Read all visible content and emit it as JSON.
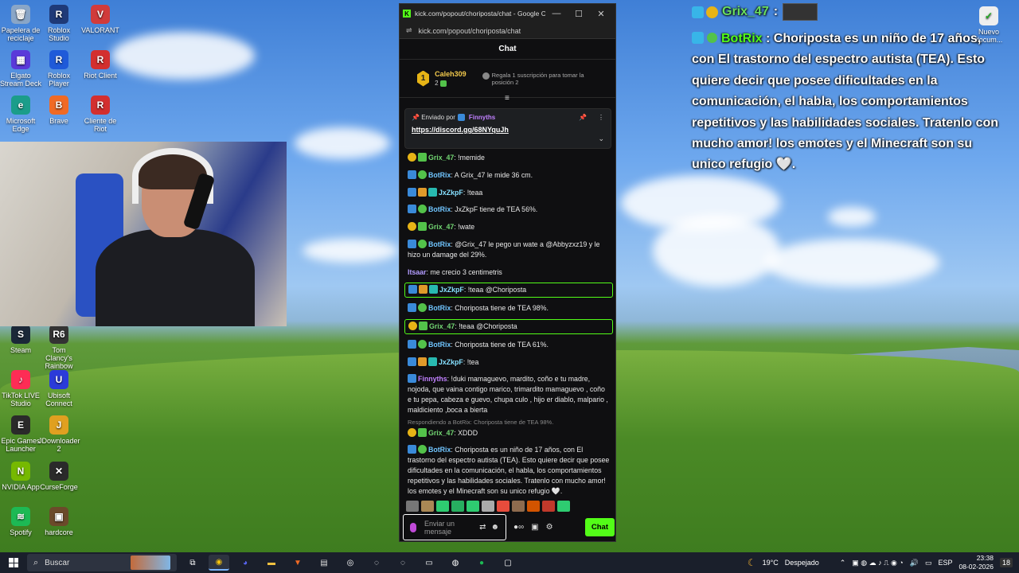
{
  "desktop": {
    "icons": [
      {
        "label": "Papelera de reciclaje",
        "color": "#8aa6c7",
        "glyph": "🗑"
      },
      {
        "label": "Roblox Studio",
        "color": "#1f3a78",
        "glyph": "R"
      },
      {
        "label": "VALORANT",
        "color": "#d13b3b",
        "glyph": "V"
      },
      {
        "label": "Elgato Stream Deck",
        "color": "#5a3ad9",
        "glyph": "▦"
      },
      {
        "label": "Roblox Player",
        "color": "#1f5ad9",
        "glyph": "R"
      },
      {
        "label": "Riot Client",
        "color": "#d32f2f",
        "glyph": "R"
      },
      {
        "label": "Microsoft Edge",
        "color": "#1b9d8a",
        "glyph": "e"
      },
      {
        "label": "Brave",
        "color": "#f06a25",
        "glyph": "B"
      },
      {
        "label": "Cliente de Riot",
        "color": "#d32f2f",
        "glyph": "R"
      },
      {
        "label": "Steam",
        "color": "#1b2838",
        "glyph": "S"
      },
      {
        "label": "Tom Clancy's Rainbow Si...",
        "color": "#333",
        "glyph": "R6"
      },
      {
        "label": "TikTok LIVE Studio",
        "color": "#fe2c55",
        "glyph": "♪"
      },
      {
        "label": "Ubisoft Connect",
        "color": "#2b3bd9",
        "glyph": "U"
      },
      {
        "label": "Epic Games Launcher",
        "color": "#2a2a2a",
        "glyph": "E"
      },
      {
        "label": "JDownloader 2",
        "color": "#e0a020",
        "glyph": "J"
      },
      {
        "label": "NVIDIA App",
        "color": "#76b900",
        "glyph": "N"
      },
      {
        "label": "CurseForge",
        "color": "#2a2a2a",
        "glyph": "✕"
      },
      {
        "label": "Spotify",
        "color": "#1db954",
        "glyph": "≋"
      },
      {
        "label": "hardcore",
        "color": "#6b4a2a",
        "glyph": "▣"
      }
    ],
    "top_right_icon": {
      "label": "Nuevo docum..."
    }
  },
  "browser": {
    "window_title": "kick.com/popout/choriposta/chat - Google C...",
    "url": "kick.com/popout/choriposta/chat",
    "chat_title": "Chat",
    "leaderboard": {
      "rank": "1",
      "user": "Caleh309",
      "subs": "2",
      "gift_text": "Regala 1 suscripción para tomar la posición 2"
    },
    "pinned": {
      "sent_by_label": "Enviado por",
      "sent_by_user": "Finnyths",
      "link": "https://discord.gg/68NYquJh"
    },
    "messages": [
      {
        "user": "Grix_47",
        "cls": "grix",
        "badges": [
          "gold",
          "green"
        ],
        "text": "!memide",
        "hl": false,
        "reply": ""
      },
      {
        "user": "BotRix",
        "cls": "bot",
        "badges": [
          "blue",
          "ok"
        ],
        "text": "A Grix_47 le mide 36 cm.",
        "hl": false,
        "reply": ""
      },
      {
        "user": "JxZkpF",
        "cls": "jx",
        "badges": [
          "blue",
          "crown",
          "teal"
        ],
        "text": "!teaa",
        "hl": false,
        "reply": ""
      },
      {
        "user": "BotRix",
        "cls": "bot",
        "badges": [
          "blue",
          "ok"
        ],
        "text": "JxZkpF tiene de TEA 56%.",
        "hl": false,
        "reply": ""
      },
      {
        "user": "Grix_47",
        "cls": "grix",
        "badges": [
          "gold",
          "green"
        ],
        "text": "!wate",
        "hl": false,
        "reply": ""
      },
      {
        "user": "BotRix",
        "cls": "bot",
        "badges": [
          "blue",
          "ok"
        ],
        "text": "@Grix_47 le pego un wate a @Abbyzxz19 y le hizo un damage del 29%.",
        "hl": false,
        "reply": ""
      },
      {
        "user": "Itsaar",
        "cls": "its",
        "badges": [],
        "text": "me crecio 3 centimetris",
        "hl": false,
        "reply": ""
      },
      {
        "user": "JxZkpF",
        "cls": "jx",
        "badges": [
          "blue",
          "crown",
          "teal"
        ],
        "text": "!teaa @Choriposta",
        "hl": true,
        "reply": ""
      },
      {
        "user": "BotRix",
        "cls": "bot",
        "badges": [
          "blue",
          "ok"
        ],
        "text": "Choriposta tiene de TEA 98%.",
        "hl": false,
        "reply": ""
      },
      {
        "user": "Grix_47",
        "cls": "grix",
        "badges": [
          "gold",
          "green"
        ],
        "text": "!teaa @Choriposta",
        "hl": true,
        "reply": ""
      },
      {
        "user": "BotRix",
        "cls": "bot",
        "badges": [
          "blue",
          "ok"
        ],
        "text": "Choriposta tiene de TEA 61%.",
        "hl": false,
        "reply": ""
      },
      {
        "user": "JxZkpF",
        "cls": "jx",
        "badges": [
          "blue",
          "crown",
          "teal"
        ],
        "text": "!tea",
        "hl": false,
        "reply": ""
      },
      {
        "user": "Finnyths",
        "cls": "fin",
        "badges": [
          "blue"
        ],
        "text": "!duki mamaguevo, mardito, coño e tu madre, nojoda, que vaina contigo marico, trimardito mamaguevo , coño e tu pepa, cabeza e guevo, chupa culo , hijo er diablo, malpario , maldiciento ,boca a bierta",
        "hl": false,
        "reply": ""
      },
      {
        "user": "Grix_47",
        "cls": "grix",
        "badges": [
          "gold",
          "green"
        ],
        "text": "XDDD",
        "hl": false,
        "reply": "Respondiendo a BotRix: Choriposta tiene de TEA 98%."
      },
      {
        "user": "BotRix",
        "cls": "bot",
        "badges": [
          "blue",
          "ok"
        ],
        "text": "Choriposta es un niño de 17 años, con El trastorno del espectro autista (TEA). Esto quiere decir que posee dificultades en la comunicación, el habla, los comportamientos repetitivos y las habilidades sociales. Tratenlo con mucho amor! los emotes y el Minecraft son su unico refugio 🤍.",
        "hl": false,
        "reply": ""
      }
    ],
    "input_placeholder": "Enviar un mensaje",
    "send_label": "Chat"
  },
  "overlay": {
    "top_user": "Grix_47",
    "msg_user": "BotRix",
    "msg_text": "Choriposta es un niño de 17 años, con El trastorno del espectro autista (TEA). Esto quiere decir que posee dificultades en la comunicación, el habla, los comportamientos repetitivos y las habilidades sociales. Tratenlo con mucho amor! los emotes y el Minecraft son su unico refugio 🤍."
  },
  "taskbar": {
    "search_label": "Buscar",
    "weather": "19°C",
    "weather_desc": "Despejado",
    "lang": "ESP",
    "time": "23:38",
    "date": "08-02-2026",
    "notif_count": "18"
  }
}
